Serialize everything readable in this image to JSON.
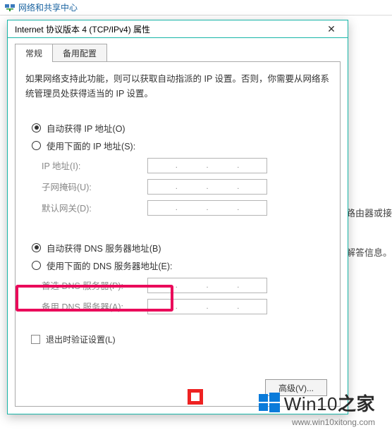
{
  "parent_window_title": "网络和共享中心",
  "right_texts": {
    "rt1": "置路由器或接",
    "rt2": "解答信息。"
  },
  "dialog": {
    "title": "Internet 协议版本 4 (TCP/IPv4) 属性",
    "close_glyph": "✕",
    "tabs": {
      "general": "常规",
      "alt": "备用配置"
    },
    "description": "如果网络支持此功能，则可以获取自动指派的 IP 设置。否则，你需要从网络系统管理员处获得适当的 IP 设置。",
    "ip_auto": "自动获得 IP 地址(O)",
    "ip_manual": "使用下面的 IP 地址(S):",
    "ip_label": "IP 地址(I):",
    "mask_label": "子网掩码(U):",
    "gateway_label": "默认网关(D):",
    "dns_auto": "自动获得 DNS 服务器地址(B)",
    "dns_manual": "使用下面的 DNS 服务器地址(E):",
    "dns1_label": "首选 DNS 服务器(P):",
    "dns2_label": "备用 DNS 服务器(A):",
    "validate": "退出时验证设置(L)",
    "advanced": "高级(V)..."
  },
  "watermark": {
    "brand": "Win10",
    "suffix": "之家",
    "url": "www.win10xitong.com"
  }
}
